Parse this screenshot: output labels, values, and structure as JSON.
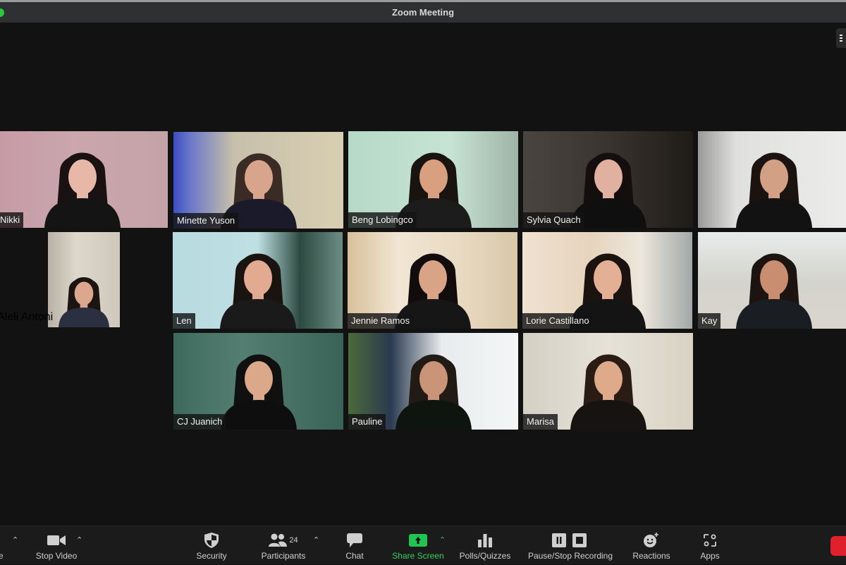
{
  "window": {
    "title": "Zoom Meeting"
  },
  "participants": [
    {
      "name": "Nikki",
      "bg": "linear-gradient(90deg,#c79aa6 0%,#caa6ad 45%,#c4a3a8 100%)",
      "shirt": "#141414",
      "hair": "#1a1212",
      "skin": "#e7b8a8"
    },
    {
      "name": "Minette Yuson",
      "bg": "linear-gradient(90deg,#3c4fc2 0%,#6b78c9 10%,#c7bfaa 35%,#d8cfb3 100%)",
      "shirt": "#1a1a2a",
      "hair": "#3a2c24",
      "skin": "#d9a48c"
    },
    {
      "name": "Beng Lobingco",
      "bg": "linear-gradient(90deg,#b7d9c8 0%,#c6e3d3 60%,#9fb4a6 100%)",
      "shirt": "#1c1c1c",
      "hair": "#1a1410",
      "skin": "#d9a080"
    },
    {
      "name": "Sylvia Quach",
      "bg": "linear-gradient(90deg,#4a4540 0%,#3a3430 50%,#1e1b18 100%)",
      "shirt": "#0f0f0f",
      "hair": "#140f0e",
      "skin": "#e0b0a0"
    },
    {
      "name": "",
      "bg": "linear-gradient(90deg,#9a9a98 0%,#e0e0de 25%,#ececea 100%)",
      "shirt": "#121212",
      "hair": "#1a1310",
      "skin": "#d2a085"
    },
    {
      "name": "Aleli Antoni",
      "bg": "linear-gradient(90deg,#b9b1a5 0%,#ddd7cc 40%,#cfc8bc 100%)",
      "shirt": "#2a3040",
      "hair": "#1c1410",
      "skin": "#dba88e"
    },
    {
      "name": "Len",
      "bg": "linear-gradient(90deg,#b7dbe0 0%,#bfe0e3 50%,#2c4a40 75%,#6d8d84 100%)",
      "shirt": "#1a1a1a",
      "hair": "#1a1410",
      "skin": "#e2aa90"
    },
    {
      "name": "Jennie Ramos",
      "bg": "linear-gradient(90deg,#d8c09a 0%,#f1e6d4 30%,#e8d8c0 70%,#d8c8a8 100%)",
      "shirt": "#161616",
      "hair": "#120d0c",
      "skin": "#d9a486"
    },
    {
      "name": "Lorie Castillano",
      "bg": "linear-gradient(90deg,#efe2d0 0%,#e6d4bd 40%,#ece6dc 70%,#a2a8a8 100%)",
      "shirt": "#141414",
      "hair": "#1b1310",
      "skin": "#e3b096"
    },
    {
      "name": "Kay",
      "bg": "linear-gradient(180deg,#e8ecec 0%,#d3d4cd 50%,#d9d5cc 100%)",
      "shirt": "#1a1d22",
      "hair": "#1c1410",
      "skin": "#c98e70"
    },
    {
      "name": "CJ Juanich",
      "bg": "linear-gradient(90deg,#3e6a5e 0%,#557e72 40%,#3a6358 100%)",
      "shirt": "#0e0e0e",
      "hair": "#101010",
      "skin": "#dca88a"
    },
    {
      "name": "Pauline",
      "bg": "linear-gradient(90deg,#4a6a3a 0%,#2a3a50 25%,#e8ecee 55%,#f4f6f6 100%)",
      "shirt": "#0e140e",
      "hair": "#221a14",
      "skin": "#c99478"
    },
    {
      "name": "Marisa",
      "bg": "linear-gradient(90deg,#d4d0c4 0%,#e6e2d8 50%,#d8d2c4 100%)",
      "shirt": "#161310",
      "hair": "#2a1c14",
      "skin": "#deaa8a"
    }
  ],
  "toolbar": {
    "items": [
      {
        "label": "Stop Video",
        "icon": "video-camera"
      },
      {
        "label": "Security",
        "icon": "shield"
      },
      {
        "label": "Participants",
        "icon": "participants",
        "count": "24"
      },
      {
        "label": "Chat",
        "icon": "chat-bubble"
      },
      {
        "label": "Share Screen",
        "icon": "share-screen"
      },
      {
        "label": "Polls/Quizzes",
        "icon": "bar-chart"
      },
      {
        "label": "Pause/Stop Recording",
        "icon": "pause-stop"
      },
      {
        "label": "Reactions",
        "icon": "emoji-plus"
      },
      {
        "label": "Apps",
        "icon": "apps"
      }
    ],
    "mute_label_fragment": "e"
  },
  "colors": {
    "share_green": "#2fd060",
    "end_red": "#e0202a",
    "titlebar": "#2f3032"
  }
}
